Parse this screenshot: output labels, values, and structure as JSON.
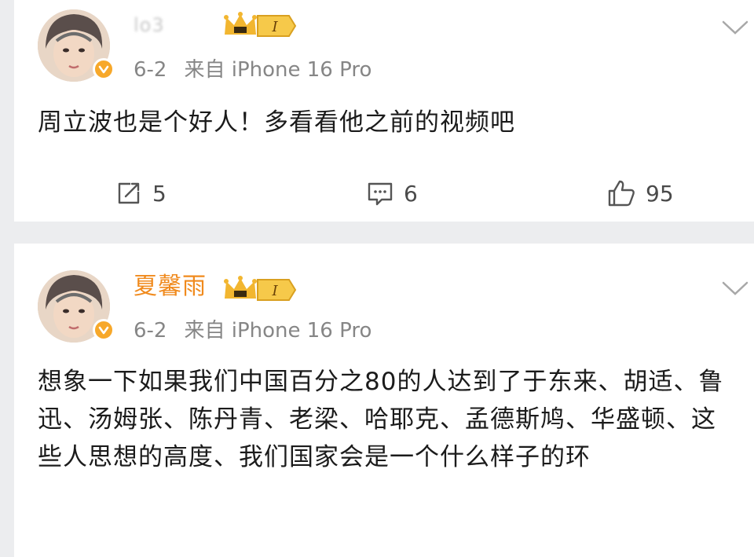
{
  "posts": [
    {
      "username": "lo3",
      "meta": {
        "date": "6-2",
        "source": "来自 iPhone 16 Pro"
      },
      "badge": {
        "level": "I"
      },
      "content": "周立波也是个好人！多看看他之前的视频吧",
      "stats": {
        "reposts": "5",
        "comments": "6",
        "likes": "95"
      }
    },
    {
      "username": "夏馨雨",
      "meta": {
        "date": "6-2",
        "source": "来自 iPhone 16 Pro"
      },
      "badge": {
        "level": "I"
      },
      "content": "想象一下如果我们中国百分之80的人达到了于东来、胡适、鲁迅、汤姆张、陈丹青、老梁、哈耶克、孟德斯鸠、华盛顿、这些人思想的高度、我们国家会是一个什么样子的环"
    }
  ],
  "colors": {
    "username": "#f08a1d",
    "meta_text": "#868686",
    "content_text": "#1b1b1b",
    "badge_gold": "#f2b630",
    "verified": "#f7a82a",
    "page_bg": "#ecedef",
    "card_bg": "#ffffff"
  },
  "icons": {
    "repost": "repost-icon",
    "comment": "comment-icon",
    "like": "like-icon",
    "more": "chevron-down-icon",
    "verified": "verified-badge-icon",
    "level": "crown-level-badge-icon"
  }
}
